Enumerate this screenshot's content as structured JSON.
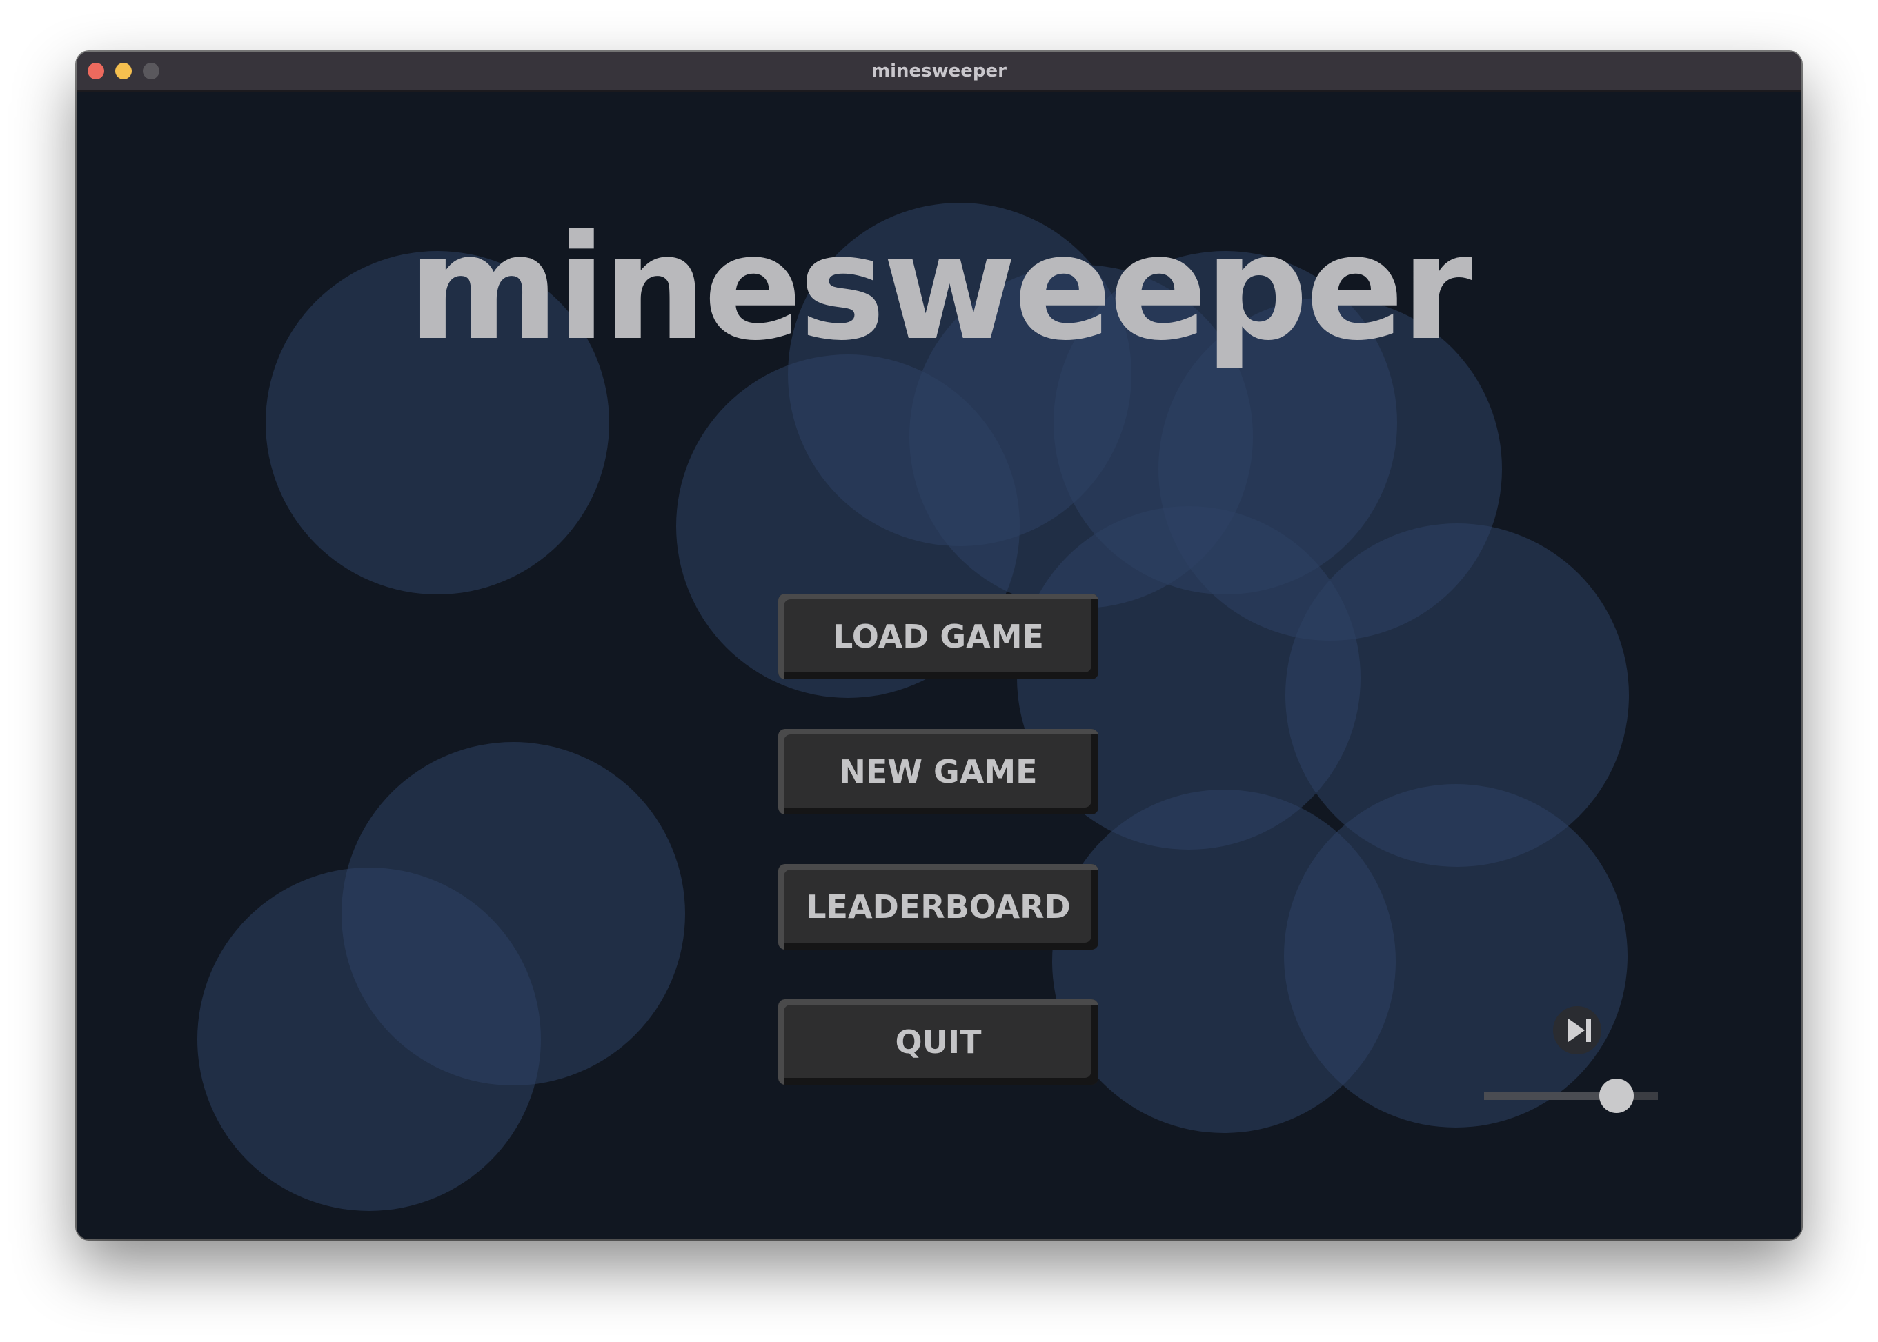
{
  "window": {
    "title": "minesweeper"
  },
  "app": {
    "title": "minesweeper"
  },
  "menu": {
    "buttons": [
      {
        "label": "LOAD GAME"
      },
      {
        "label": "NEW GAME"
      },
      {
        "label": "LEADERBOARD"
      },
      {
        "label": "QUIT"
      }
    ]
  },
  "music": {
    "skip_icon": "skip-forward-icon",
    "volume_fraction": 0.76
  },
  "colors": {
    "background": "#111721",
    "bubble": "#2d4164",
    "title_text": "#b9b9bc",
    "button_face": "#2e2e2f",
    "button_text": "#c4c4c6",
    "titlebar": "#37343b"
  }
}
